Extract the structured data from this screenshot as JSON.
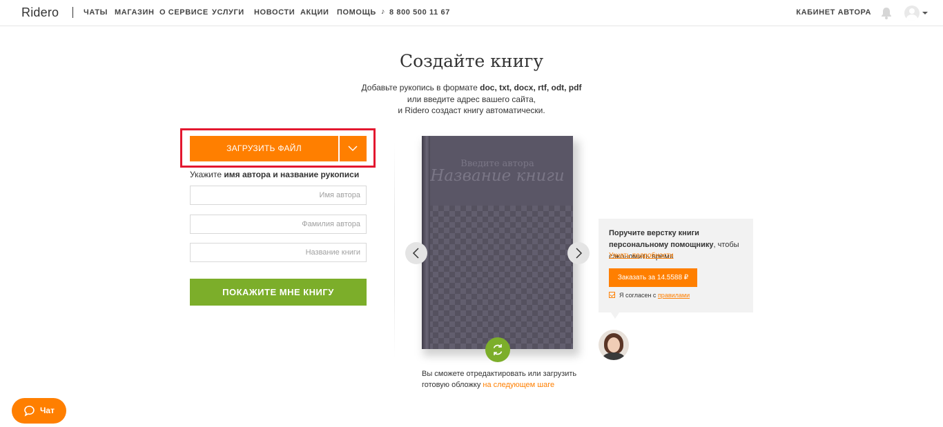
{
  "header": {
    "logo": "Ridero",
    "nav": [
      "ЧАТЫ",
      "МАГАЗИН",
      "О СЕРВИСЕ",
      "УСЛУГИ",
      "НОВОСТИ",
      "АКЦИИ",
      "ПОМОЩЬ"
    ],
    "phone": "8 800 500 11 67",
    "cabinet": "КАБИНЕТ АВТОРА"
  },
  "main": {
    "title": "Создайте книгу",
    "subtitle_line1_prefix": "Добавьте рукопись в формате ",
    "subtitle_line1_formats": "doc, txt, docx, rtf, odt, pdf",
    "subtitle_line2": "или введите адрес вашего сайта,",
    "subtitle_line3": "и Ridero создаст книгу автоматически."
  },
  "upload": {
    "button_label": "ЗАГРУЗИТЬ ФАЙЛ",
    "hint_prefix": "Укажите ",
    "hint_bold": "имя автора и название рукописи",
    "author_first_placeholder": "Имя автора",
    "author_last_placeholder": "Фамилия автора",
    "book_title_placeholder": "Название книги",
    "show_button_label": "ПОКАЖИТЕ МНЕ КНИГУ"
  },
  "book": {
    "author_placeholder": "Введите автора",
    "title_placeholder": "Название книги",
    "note_text": "Вы сможете отредактировать или загрузить готовую обложку ",
    "note_link": "на следующем шаге"
  },
  "help_card": {
    "text_bold": "Поручите верстку книги персональному помощнику",
    "text_rest": ", чтобы сэкономить время",
    "link": "Узнать подробности",
    "order_button": "Заказать за 14.5588 ₽",
    "agree_text": "Я согласен с ",
    "agree_link": "правилами",
    "agree_checked": true
  },
  "chat": {
    "label": "Чат"
  },
  "colors": {
    "accent_orange": "#ff7f00",
    "accent_green": "#7cae2a",
    "highlight_red": "#e3172f",
    "book_cover": "#5a5666"
  },
  "icons": [
    "phone-icon",
    "bell-icon",
    "user-avatar-icon",
    "chevron-down-icon",
    "chevron-left-icon",
    "chevron-right-icon",
    "refresh-icon",
    "chat-bubble-icon"
  ]
}
